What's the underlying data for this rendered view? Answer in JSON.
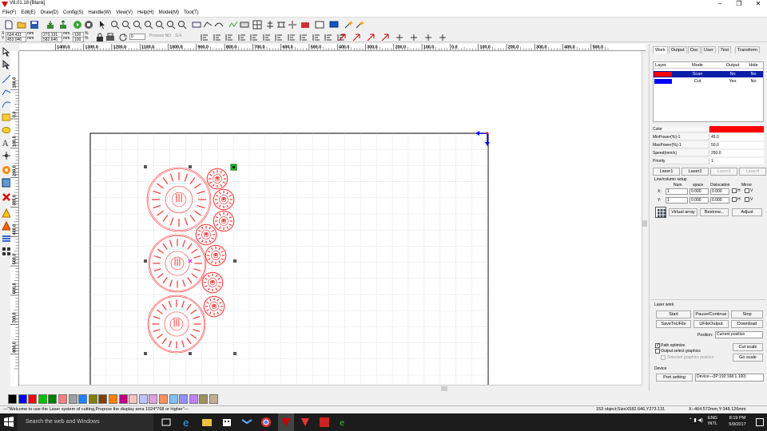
{
  "window": {
    "title": "V8.01.18-[Blank]",
    "controls": {
      "minimize": "–",
      "maximize": "❐",
      "close": "✕"
    }
  },
  "menu": [
    "File(F)",
    "Edit(E)",
    "Draw(D)",
    "Config(S)",
    "Handle(W)",
    "View(V)",
    "Help(H)",
    "Model(M)",
    "Tool(T)"
  ],
  "toolbar": {
    "x_value": "634.431",
    "y_value": "453.046",
    "unit": "mm",
    "w_value": "273.131",
    "h_value": "582.646",
    "w_unit": "mm",
    "h_unit": "mm",
    "x_label": "X",
    "y_label": "Y",
    "pct_w": "100",
    "pct_h": "100",
    "pct_unit": "%",
    "angle": "0",
    "process_no_label": "Process NO:",
    "process_no": "114"
  },
  "hruler_ticks": [
    "1400.0",
    "1300.0",
    "1200.0",
    "1100.0",
    "1000.0",
    "900.0",
    "800.0",
    "700.0",
    "600.0",
    "500.0",
    "400.0",
    "300.0",
    "200.0",
    "100.0",
    "0.0",
    "100.0",
    "200.0",
    "300.0",
    "400.0",
    "500.0"
  ],
  "vruler_ticks": [
    "100.0",
    "0.0",
    "100.0",
    "200.0",
    "300.0",
    "400.0",
    "500.0",
    "600.0",
    "700.0",
    "800.0"
  ],
  "panel": {
    "tabs": [
      "Work",
      "Output",
      "Doc",
      "User",
      "Test",
      "Transform"
    ],
    "layer_headers": [
      "Layer",
      "Mode",
      "Output",
      "Hide"
    ],
    "layers": [
      {
        "color": "#ff0000",
        "mode": "Scan",
        "output": "No",
        "hide": "No",
        "selected": true
      },
      {
        "color": "#0000ff",
        "mode": "Cut",
        "output": "Yes",
        "hide": "No",
        "selected": false
      }
    ],
    "props": [
      {
        "label": "Color",
        "value": ""
      },
      {
        "label": "MinPower(%)-1",
        "value": "45.0"
      },
      {
        "label": "MaxPower(%)-1",
        "value": "50.0"
      },
      {
        "label": "Speed(mm/s)",
        "value": "250.0"
      },
      {
        "label": "Priority",
        "value": "1"
      }
    ],
    "prop_color": "#ff0000",
    "laser_tabs": [
      "Laser1",
      "Laser2",
      "Laser3",
      "Laser4"
    ],
    "array_title": "Line/column setup",
    "array_headers": [
      "Num",
      "space",
      "Dislocation",
      "Mirror"
    ],
    "array_rows": [
      {
        "axis": "X:",
        "num": "1",
        "space": "0.000",
        "disloc": "0.000",
        "h": "H",
        "v": "V"
      },
      {
        "axis": "Y:",
        "num": "1",
        "space": "0.000",
        "disloc": "0.000",
        "h": "H",
        "v": "V"
      }
    ],
    "array_buttons": [
      "Virtual array",
      "Bestrew...",
      "Adjust"
    ],
    "laserwork_title": "Laser work",
    "lw_buttons": [
      "Start",
      "Pause/Continue",
      "Stop",
      "SaveToUFile",
      "UFileOutput",
      "Download"
    ],
    "position_label": "Position:",
    "position_value": "Current position",
    "checks": [
      {
        "label": "Path optimize",
        "checked": true
      },
      {
        "label": "Output select graphics",
        "checked": false
      },
      {
        "label": "Selected graphics position",
        "checked": false
      }
    ],
    "cut_scale": "Cut scale",
    "go_scale": "Go scale",
    "device_title": "Device",
    "port_setting": "Port setting",
    "device_value": "Device---(IP:192.168.1.100)"
  },
  "palette": [
    "#000000",
    "#0000ff",
    "#ff0000",
    "#00c000",
    "#008000",
    "#ff8080",
    "#a0a0a0",
    "#2080ff",
    "#808000",
    "#804000",
    "#ff8000",
    "#c00080",
    "#ffc0c0",
    "#c0c0ff",
    "#e0a0e0",
    "#ff9060",
    "#80c0ff",
    "#9090ff",
    "#c080ff",
    "#a09060",
    "#c0b090"
  ],
  "status": {
    "message": "---\"Welcome to use the Laser system of cutting,Propose the display area 1024*768 or higher\"---",
    "objects": "153 object;SizeX582.646,Y273.131",
    "coords": "X:-464.572mm,Y:348.126mm"
  },
  "taskbar": {
    "search": "Search the web and Windows",
    "lang": "ENG",
    "lang2": "INTL",
    "time": "8:19 PM",
    "date": "5/9/2017"
  }
}
